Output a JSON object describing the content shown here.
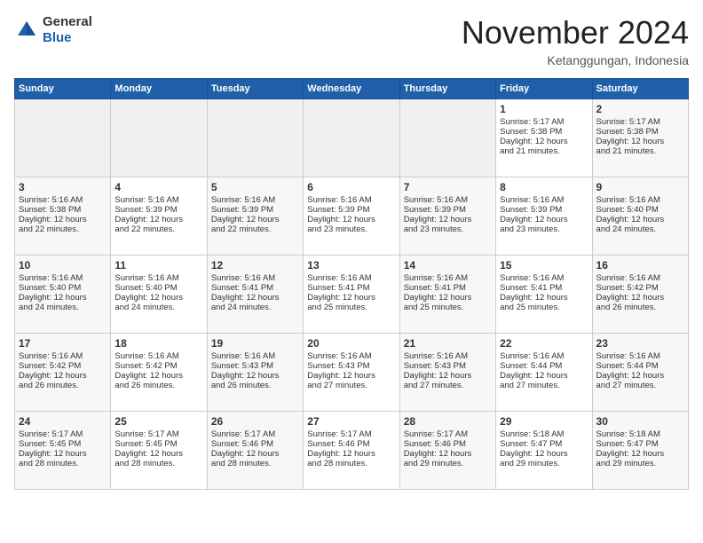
{
  "header": {
    "logo_line1": "General",
    "logo_line2": "Blue",
    "month": "November 2024",
    "location": "Ketanggungan, Indonesia"
  },
  "days_of_week": [
    "Sunday",
    "Monday",
    "Tuesday",
    "Wednesday",
    "Thursday",
    "Friday",
    "Saturday"
  ],
  "weeks": [
    [
      {
        "day": "",
        "info": ""
      },
      {
        "day": "",
        "info": ""
      },
      {
        "day": "",
        "info": ""
      },
      {
        "day": "",
        "info": ""
      },
      {
        "day": "",
        "info": ""
      },
      {
        "day": "1",
        "info": "Sunrise: 5:17 AM\nSunset: 5:38 PM\nDaylight: 12 hours\nand 21 minutes."
      },
      {
        "day": "2",
        "info": "Sunrise: 5:17 AM\nSunset: 5:38 PM\nDaylight: 12 hours\nand 21 minutes."
      }
    ],
    [
      {
        "day": "3",
        "info": "Sunrise: 5:16 AM\nSunset: 5:38 PM\nDaylight: 12 hours\nand 22 minutes."
      },
      {
        "day": "4",
        "info": "Sunrise: 5:16 AM\nSunset: 5:39 PM\nDaylight: 12 hours\nand 22 minutes."
      },
      {
        "day": "5",
        "info": "Sunrise: 5:16 AM\nSunset: 5:39 PM\nDaylight: 12 hours\nand 22 minutes."
      },
      {
        "day": "6",
        "info": "Sunrise: 5:16 AM\nSunset: 5:39 PM\nDaylight: 12 hours\nand 23 minutes."
      },
      {
        "day": "7",
        "info": "Sunrise: 5:16 AM\nSunset: 5:39 PM\nDaylight: 12 hours\nand 23 minutes."
      },
      {
        "day": "8",
        "info": "Sunrise: 5:16 AM\nSunset: 5:39 PM\nDaylight: 12 hours\nand 23 minutes."
      },
      {
        "day": "9",
        "info": "Sunrise: 5:16 AM\nSunset: 5:40 PM\nDaylight: 12 hours\nand 24 minutes."
      }
    ],
    [
      {
        "day": "10",
        "info": "Sunrise: 5:16 AM\nSunset: 5:40 PM\nDaylight: 12 hours\nand 24 minutes."
      },
      {
        "day": "11",
        "info": "Sunrise: 5:16 AM\nSunset: 5:40 PM\nDaylight: 12 hours\nand 24 minutes."
      },
      {
        "day": "12",
        "info": "Sunrise: 5:16 AM\nSunset: 5:41 PM\nDaylight: 12 hours\nand 24 minutes."
      },
      {
        "day": "13",
        "info": "Sunrise: 5:16 AM\nSunset: 5:41 PM\nDaylight: 12 hours\nand 25 minutes."
      },
      {
        "day": "14",
        "info": "Sunrise: 5:16 AM\nSunset: 5:41 PM\nDaylight: 12 hours\nand 25 minutes."
      },
      {
        "day": "15",
        "info": "Sunrise: 5:16 AM\nSunset: 5:41 PM\nDaylight: 12 hours\nand 25 minutes."
      },
      {
        "day": "16",
        "info": "Sunrise: 5:16 AM\nSunset: 5:42 PM\nDaylight: 12 hours\nand 26 minutes."
      }
    ],
    [
      {
        "day": "17",
        "info": "Sunrise: 5:16 AM\nSunset: 5:42 PM\nDaylight: 12 hours\nand 26 minutes."
      },
      {
        "day": "18",
        "info": "Sunrise: 5:16 AM\nSunset: 5:42 PM\nDaylight: 12 hours\nand 26 minutes."
      },
      {
        "day": "19",
        "info": "Sunrise: 5:16 AM\nSunset: 5:43 PM\nDaylight: 12 hours\nand 26 minutes."
      },
      {
        "day": "20",
        "info": "Sunrise: 5:16 AM\nSunset: 5:43 PM\nDaylight: 12 hours\nand 27 minutes."
      },
      {
        "day": "21",
        "info": "Sunrise: 5:16 AM\nSunset: 5:43 PM\nDaylight: 12 hours\nand 27 minutes."
      },
      {
        "day": "22",
        "info": "Sunrise: 5:16 AM\nSunset: 5:44 PM\nDaylight: 12 hours\nand 27 minutes."
      },
      {
        "day": "23",
        "info": "Sunrise: 5:16 AM\nSunset: 5:44 PM\nDaylight: 12 hours\nand 27 minutes."
      }
    ],
    [
      {
        "day": "24",
        "info": "Sunrise: 5:17 AM\nSunset: 5:45 PM\nDaylight: 12 hours\nand 28 minutes."
      },
      {
        "day": "25",
        "info": "Sunrise: 5:17 AM\nSunset: 5:45 PM\nDaylight: 12 hours\nand 28 minutes."
      },
      {
        "day": "26",
        "info": "Sunrise: 5:17 AM\nSunset: 5:46 PM\nDaylight: 12 hours\nand 28 minutes."
      },
      {
        "day": "27",
        "info": "Sunrise: 5:17 AM\nSunset: 5:46 PM\nDaylight: 12 hours\nand 28 minutes."
      },
      {
        "day": "28",
        "info": "Sunrise: 5:17 AM\nSunset: 5:46 PM\nDaylight: 12 hours\nand 29 minutes."
      },
      {
        "day": "29",
        "info": "Sunrise: 5:18 AM\nSunset: 5:47 PM\nDaylight: 12 hours\nand 29 minutes."
      },
      {
        "day": "30",
        "info": "Sunrise: 5:18 AM\nSunset: 5:47 PM\nDaylight: 12 hours\nand 29 minutes."
      }
    ]
  ]
}
